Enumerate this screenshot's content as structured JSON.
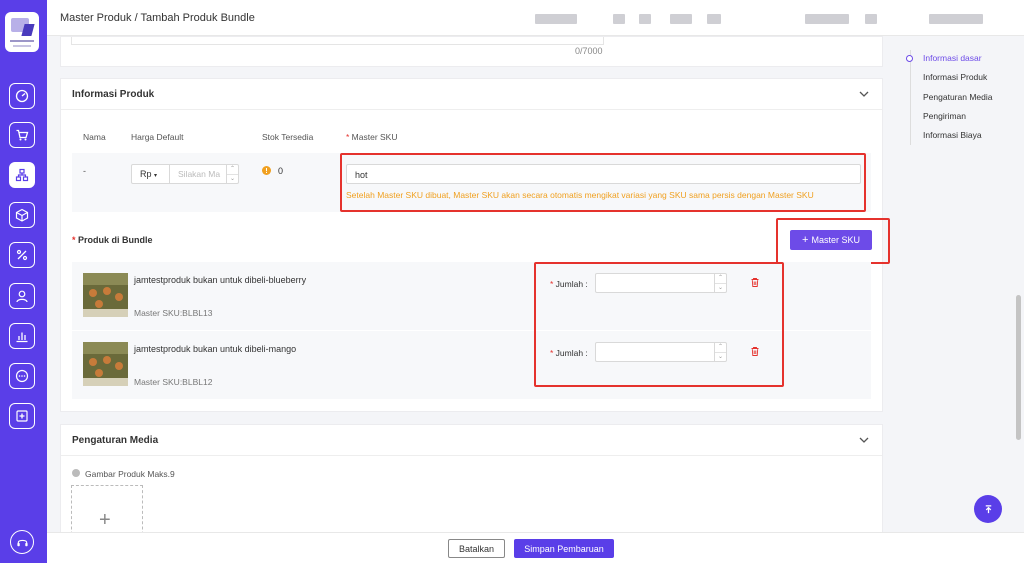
{
  "header": {
    "breadcrumb": "Master Produk / Tambah Produk Bundle"
  },
  "description": {
    "char_count": "0/7000"
  },
  "product_info": {
    "title": "Informasi Produk",
    "columns": {
      "name": "Nama",
      "price": "Harga Default",
      "stock": "Stok Tersedia",
      "sku": "Master SKU"
    },
    "row": {
      "name": "-",
      "currency": "Rp",
      "price_placeholder": "Silakan Ma",
      "stock": "0",
      "sku_value": "hot",
      "hint": "Setelah Master SKU dibuat, Master SKU akan secara otomatis mengikat variasi yang SKU sama persis dengan Master SKU"
    }
  },
  "bundle": {
    "title": "Produk di Bundle",
    "add_button": "Master SKU",
    "qty_label": "Jumlah :",
    "items": [
      {
        "name": "jamtestproduk bukan untuk dibeli-blueberry",
        "sku": "Master SKU:BLBL13"
      },
      {
        "name": "jamtestproduk bukan untuk dibeli-mango",
        "sku": "Master SKU:BLBL12"
      }
    ]
  },
  "media": {
    "title": "Pengaturan Media",
    "image_label": "Gambar Produk Maks.9"
  },
  "right_nav": {
    "items": [
      "Informasi dasar",
      "Informasi Produk",
      "Pengaturan Media",
      "Pengiriman",
      "Informasi Biaya"
    ]
  },
  "footer": {
    "cancel": "Batalkan",
    "save": "Simpan Pembaruan"
  },
  "colors": {
    "accent": "#5a3ee8",
    "button": "#6d4be8",
    "warning": "#f0a020",
    "highlight": "#e5322d"
  }
}
